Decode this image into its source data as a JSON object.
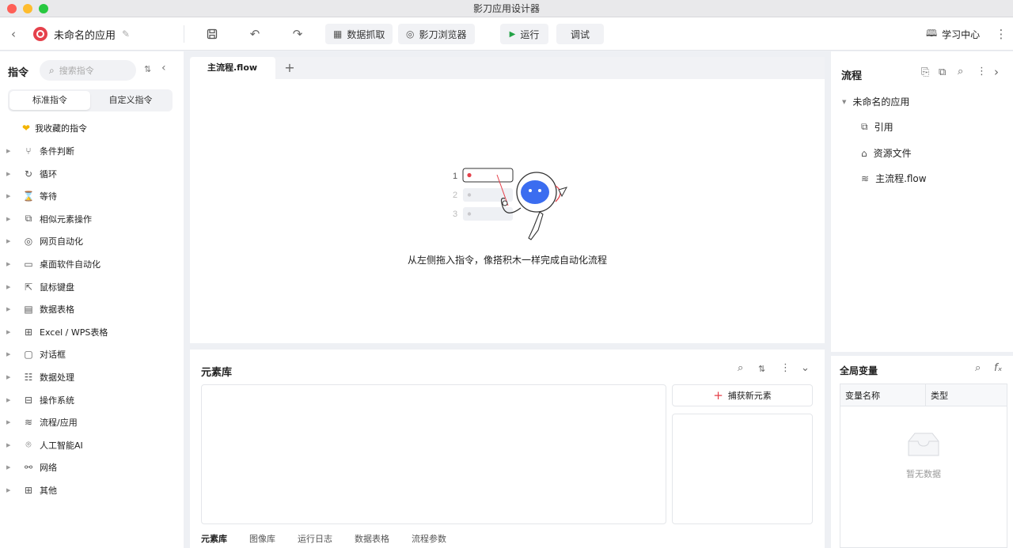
{
  "window": {
    "title": "影刀应用设计器"
  },
  "toolbar": {
    "app_name": "未命名的应用",
    "capture_label": "数据抓取",
    "browser_label": "影刀浏览器",
    "run_label": "运行",
    "debug_label": "调试",
    "learn_label": "学习中心"
  },
  "commands": {
    "title": "指令",
    "search_placeholder": "搜索指令",
    "tab_standard": "标准指令",
    "tab_custom": "自定义指令",
    "favorites": "我收藏的指令",
    "categories": [
      "条件判断",
      "循环",
      "等待",
      "相似元素操作",
      "网页自动化",
      "桌面软件自动化",
      "鼠标键盘",
      "数据表格",
      "Excel / WPS表格",
      "对话框",
      "数据处理",
      "操作系统",
      "流程/应用",
      "人工智能AI",
      "网络",
      "其他"
    ],
    "icons": [
      "branch-icon",
      "loop-icon",
      "hourglass-icon",
      "similar-elements-icon",
      "web-icon",
      "monitor-icon",
      "cursor-icon",
      "sheet-icon",
      "excel-icon",
      "dialog-icon",
      "data-icon",
      "os-icon",
      "layers-icon",
      "ai-icon",
      "network-icon",
      "grid-icon"
    ]
  },
  "editor": {
    "tab_label": "主流程.flow",
    "empty_hint": "从左侧拖入指令，像搭积木一样完成自动化流程",
    "step_numbers": [
      "1",
      "2",
      "3"
    ]
  },
  "element_lib": {
    "title": "元素库",
    "capture_button": "捕获新元素",
    "tabs": [
      "元素库",
      "图像库",
      "运行日志",
      "数据表格",
      "流程参数"
    ]
  },
  "flow_panel": {
    "title": "流程",
    "root": "未命名的应用",
    "items": [
      "引用",
      "资源文件",
      "主流程.flow"
    ]
  },
  "globals": {
    "title": "全局变量",
    "col_name": "变量名称",
    "col_type": "类型",
    "empty": "暂无数据"
  },
  "colors": {
    "accent": "#e5414b",
    "run_green": "#23a347",
    "robot_blue": "#3b6df0"
  }
}
